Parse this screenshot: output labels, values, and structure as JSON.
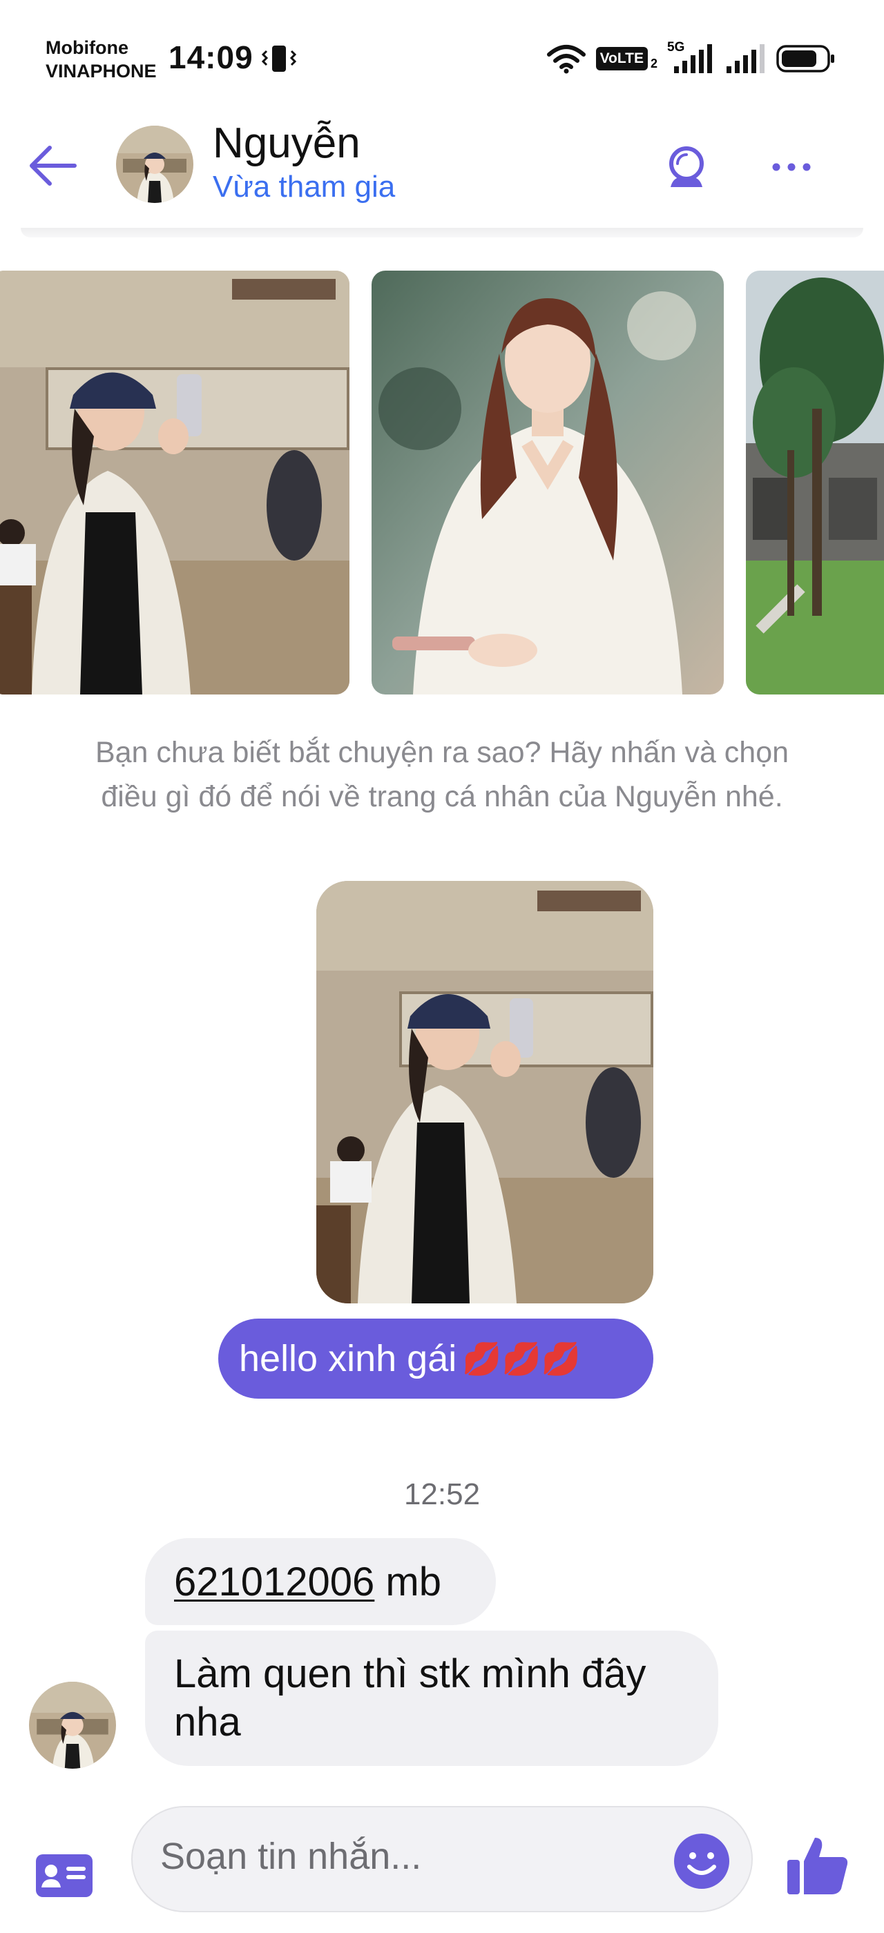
{
  "status_bar": {
    "carrier_1": "Mobifone",
    "carrier_2": "VINAPHONE",
    "time": "14:09",
    "volte": "VoLTE",
    "network": "5G",
    "sim_slot": "2"
  },
  "header": {
    "contact_name": "Nguyễn",
    "contact_status": "Vừa tham gia",
    "icons": [
      "back-arrow-icon",
      "video-call-icon",
      "more-icon"
    ]
  },
  "carousel": {
    "photos": [
      "photo-selfie-cap",
      "photo-white-dress",
      "photo-garden"
    ]
  },
  "hint_text": "Bạn chưa biết bắt chuyện ra sao? Hãy nhấn và chọn điều gì đó để nói về trang cá nhân của Nguyễn nhé.",
  "messages": {
    "outgoing_text": "hello xinh gái",
    "outgoing_emoji": "💋💋💋",
    "timestamp": "12:52",
    "incoming_1_account": "621012006",
    "incoming_1_suffix": " mb",
    "incoming_2": "Làm quen thì stk mình đây nha"
  },
  "composer": {
    "placeholder": "Soạn tin nhắn..."
  },
  "colors": {
    "accent": "#6a5cdc",
    "link_blue": "#3b6ff0",
    "bubble_incoming": "#f0f0f3",
    "icon_purple": "#6a5cdc"
  }
}
